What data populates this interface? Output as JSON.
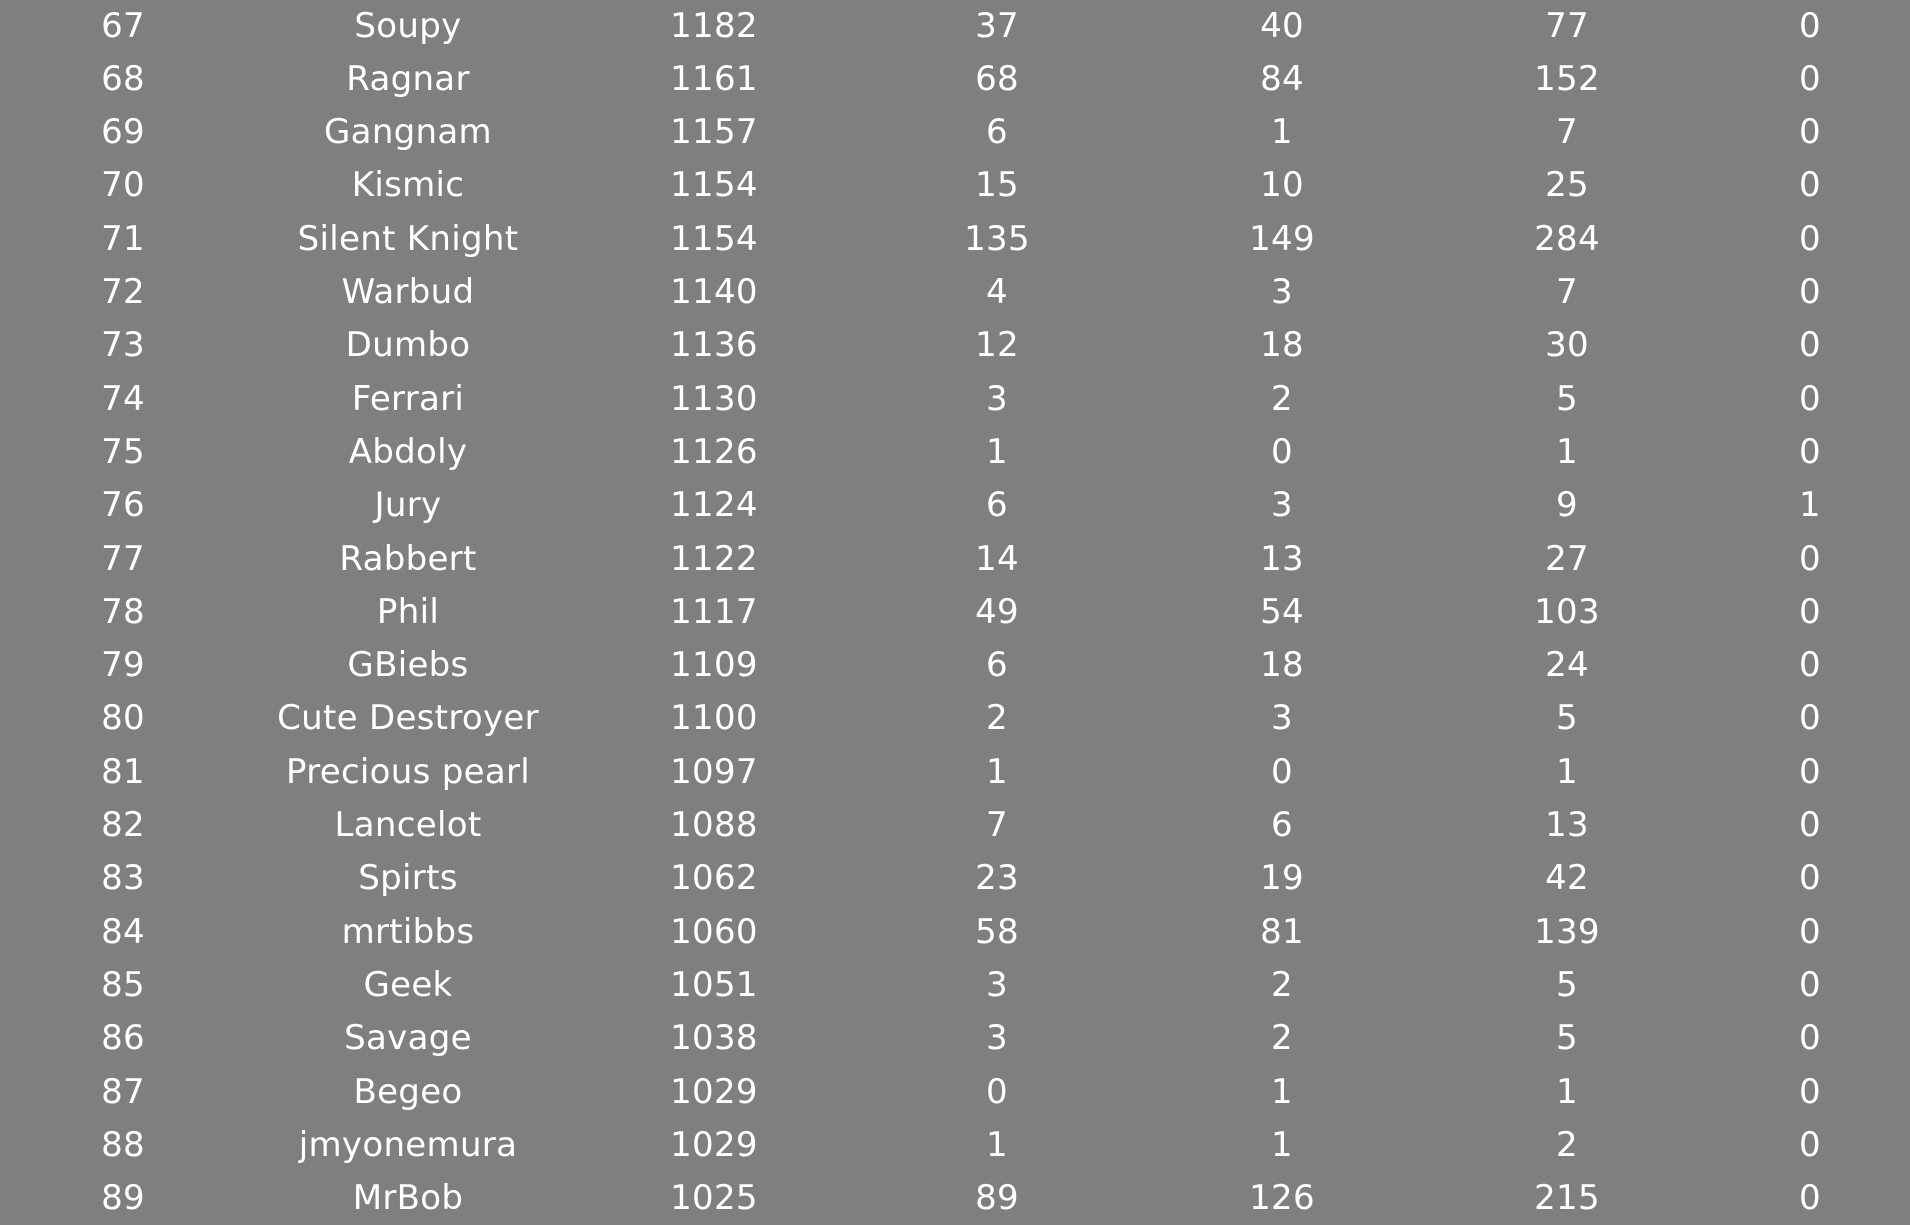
{
  "table": {
    "rows": [
      {
        "rank": "67",
        "name": "Soupy",
        "rating": "1182",
        "col3": "37",
        "col4": "40",
        "col5": "77",
        "col6": "0"
      },
      {
        "rank": "68",
        "name": "Ragnar",
        "rating": "1161",
        "col3": "68",
        "col4": "84",
        "col5": "152",
        "col6": "0"
      },
      {
        "rank": "69",
        "name": "Gangnam",
        "rating": "1157",
        "col3": "6",
        "col4": "1",
        "col5": "7",
        "col6": "0"
      },
      {
        "rank": "70",
        "name": "Kismic",
        "rating": "1154",
        "col3": "15",
        "col4": "10",
        "col5": "25",
        "col6": "0"
      },
      {
        "rank": "71",
        "name": "Silent Knight",
        "rating": "1154",
        "col3": "135",
        "col4": "149",
        "col5": "284",
        "col6": "0"
      },
      {
        "rank": "72",
        "name": "Warbud",
        "rating": "1140",
        "col3": "4",
        "col4": "3",
        "col5": "7",
        "col6": "0"
      },
      {
        "rank": "73",
        "name": "Dumbo",
        "rating": "1136",
        "col3": "12",
        "col4": "18",
        "col5": "30",
        "col6": "0"
      },
      {
        "rank": "74",
        "name": "Ferrari",
        "rating": "1130",
        "col3": "3",
        "col4": "2",
        "col5": "5",
        "col6": "0"
      },
      {
        "rank": "75",
        "name": "Abdoly",
        "rating": "1126",
        "col3": "1",
        "col4": "0",
        "col5": "1",
        "col6": "0"
      },
      {
        "rank": "76",
        "name": "Jury",
        "rating": "1124",
        "col3": "6",
        "col4": "3",
        "col5": "9",
        "col6": "1"
      },
      {
        "rank": "77",
        "name": "Rabbert",
        "rating": "1122",
        "col3": "14",
        "col4": "13",
        "col5": "27",
        "col6": "0"
      },
      {
        "rank": "78",
        "name": "Phil",
        "rating": "1117",
        "col3": "49",
        "col4": "54",
        "col5": "103",
        "col6": "0"
      },
      {
        "rank": "79",
        "name": "GBiebs",
        "rating": "1109",
        "col3": "6",
        "col4": "18",
        "col5": "24",
        "col6": "0"
      },
      {
        "rank": "80",
        "name": "Cute Destroyer",
        "rating": "1100",
        "col3": "2",
        "col4": "3",
        "col5": "5",
        "col6": "0"
      },
      {
        "rank": "81",
        "name": "Precious pearl",
        "rating": "1097",
        "col3": "1",
        "col4": "0",
        "col5": "1",
        "col6": "0"
      },
      {
        "rank": "82",
        "name": "Lancelot",
        "rating": "1088",
        "col3": "7",
        "col4": "6",
        "col5": "13",
        "col6": "0"
      },
      {
        "rank": "83",
        "name": "Spirts",
        "rating": "1062",
        "col3": "23",
        "col4": "19",
        "col5": "42",
        "col6": "0"
      },
      {
        "rank": "84",
        "name": "mrtibbs",
        "rating": "1060",
        "col3": "58",
        "col4": "81",
        "col5": "139",
        "col6": "0"
      },
      {
        "rank": "85",
        "name": "Geek",
        "rating": "1051",
        "col3": "3",
        "col4": "2",
        "col5": "5",
        "col6": "0"
      },
      {
        "rank": "86",
        "name": "Savage",
        "rating": "1038",
        "col3": "3",
        "col4": "2",
        "col5": "5",
        "col6": "0"
      },
      {
        "rank": "87",
        "name": "Begeo",
        "rating": "1029",
        "col3": "0",
        "col4": "1",
        "col5": "1",
        "col6": "0"
      },
      {
        "rank": "88",
        "name": "jmyonemura",
        "rating": "1029",
        "col3": "1",
        "col4": "1",
        "col5": "2",
        "col6": "0"
      },
      {
        "rank": "89",
        "name": "MrBob",
        "rating": "1025",
        "col3": "89",
        "col4": "126",
        "col5": "215",
        "col6": "0"
      }
    ]
  }
}
